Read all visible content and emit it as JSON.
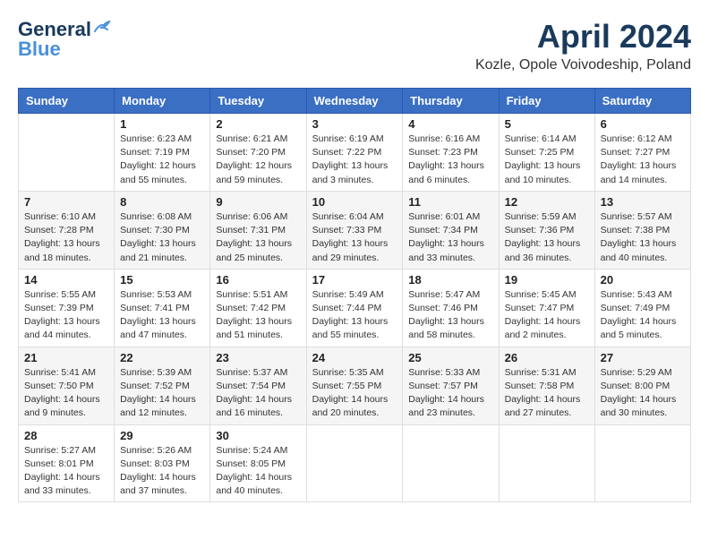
{
  "header": {
    "logo_line1": "General",
    "logo_line2": "Blue",
    "month": "April 2024",
    "location": "Kozle, Opole Voivodeship, Poland"
  },
  "columns": [
    "Sunday",
    "Monday",
    "Tuesday",
    "Wednesday",
    "Thursday",
    "Friday",
    "Saturday"
  ],
  "weeks": [
    [
      {
        "day": "",
        "info": ""
      },
      {
        "day": "1",
        "info": "Sunrise: 6:23 AM\nSunset: 7:19 PM\nDaylight: 12 hours\nand 55 minutes."
      },
      {
        "day": "2",
        "info": "Sunrise: 6:21 AM\nSunset: 7:20 PM\nDaylight: 12 hours\nand 59 minutes."
      },
      {
        "day": "3",
        "info": "Sunrise: 6:19 AM\nSunset: 7:22 PM\nDaylight: 13 hours\nand 3 minutes."
      },
      {
        "day": "4",
        "info": "Sunrise: 6:16 AM\nSunset: 7:23 PM\nDaylight: 13 hours\nand 6 minutes."
      },
      {
        "day": "5",
        "info": "Sunrise: 6:14 AM\nSunset: 7:25 PM\nDaylight: 13 hours\nand 10 minutes."
      },
      {
        "day": "6",
        "info": "Sunrise: 6:12 AM\nSunset: 7:27 PM\nDaylight: 13 hours\nand 14 minutes."
      }
    ],
    [
      {
        "day": "7",
        "info": "Sunrise: 6:10 AM\nSunset: 7:28 PM\nDaylight: 13 hours\nand 18 minutes."
      },
      {
        "day": "8",
        "info": "Sunrise: 6:08 AM\nSunset: 7:30 PM\nDaylight: 13 hours\nand 21 minutes."
      },
      {
        "day": "9",
        "info": "Sunrise: 6:06 AM\nSunset: 7:31 PM\nDaylight: 13 hours\nand 25 minutes."
      },
      {
        "day": "10",
        "info": "Sunrise: 6:04 AM\nSunset: 7:33 PM\nDaylight: 13 hours\nand 29 minutes."
      },
      {
        "day": "11",
        "info": "Sunrise: 6:01 AM\nSunset: 7:34 PM\nDaylight: 13 hours\nand 33 minutes."
      },
      {
        "day": "12",
        "info": "Sunrise: 5:59 AM\nSunset: 7:36 PM\nDaylight: 13 hours\nand 36 minutes."
      },
      {
        "day": "13",
        "info": "Sunrise: 5:57 AM\nSunset: 7:38 PM\nDaylight: 13 hours\nand 40 minutes."
      }
    ],
    [
      {
        "day": "14",
        "info": "Sunrise: 5:55 AM\nSunset: 7:39 PM\nDaylight: 13 hours\nand 44 minutes."
      },
      {
        "day": "15",
        "info": "Sunrise: 5:53 AM\nSunset: 7:41 PM\nDaylight: 13 hours\nand 47 minutes."
      },
      {
        "day": "16",
        "info": "Sunrise: 5:51 AM\nSunset: 7:42 PM\nDaylight: 13 hours\nand 51 minutes."
      },
      {
        "day": "17",
        "info": "Sunrise: 5:49 AM\nSunset: 7:44 PM\nDaylight: 13 hours\nand 55 minutes."
      },
      {
        "day": "18",
        "info": "Sunrise: 5:47 AM\nSunset: 7:46 PM\nDaylight: 13 hours\nand 58 minutes."
      },
      {
        "day": "19",
        "info": "Sunrise: 5:45 AM\nSunset: 7:47 PM\nDaylight: 14 hours\nand 2 minutes."
      },
      {
        "day": "20",
        "info": "Sunrise: 5:43 AM\nSunset: 7:49 PM\nDaylight: 14 hours\nand 5 minutes."
      }
    ],
    [
      {
        "day": "21",
        "info": "Sunrise: 5:41 AM\nSunset: 7:50 PM\nDaylight: 14 hours\nand 9 minutes."
      },
      {
        "day": "22",
        "info": "Sunrise: 5:39 AM\nSunset: 7:52 PM\nDaylight: 14 hours\nand 12 minutes."
      },
      {
        "day": "23",
        "info": "Sunrise: 5:37 AM\nSunset: 7:54 PM\nDaylight: 14 hours\nand 16 minutes."
      },
      {
        "day": "24",
        "info": "Sunrise: 5:35 AM\nSunset: 7:55 PM\nDaylight: 14 hours\nand 20 minutes."
      },
      {
        "day": "25",
        "info": "Sunrise: 5:33 AM\nSunset: 7:57 PM\nDaylight: 14 hours\nand 23 minutes."
      },
      {
        "day": "26",
        "info": "Sunrise: 5:31 AM\nSunset: 7:58 PM\nDaylight: 14 hours\nand 27 minutes."
      },
      {
        "day": "27",
        "info": "Sunrise: 5:29 AM\nSunset: 8:00 PM\nDaylight: 14 hours\nand 30 minutes."
      }
    ],
    [
      {
        "day": "28",
        "info": "Sunrise: 5:27 AM\nSunset: 8:01 PM\nDaylight: 14 hours\nand 33 minutes."
      },
      {
        "day": "29",
        "info": "Sunrise: 5:26 AM\nSunset: 8:03 PM\nDaylight: 14 hours\nand 37 minutes."
      },
      {
        "day": "30",
        "info": "Sunrise: 5:24 AM\nSunset: 8:05 PM\nDaylight: 14 hours\nand 40 minutes."
      },
      {
        "day": "",
        "info": ""
      },
      {
        "day": "",
        "info": ""
      },
      {
        "day": "",
        "info": ""
      },
      {
        "day": "",
        "info": ""
      }
    ]
  ]
}
